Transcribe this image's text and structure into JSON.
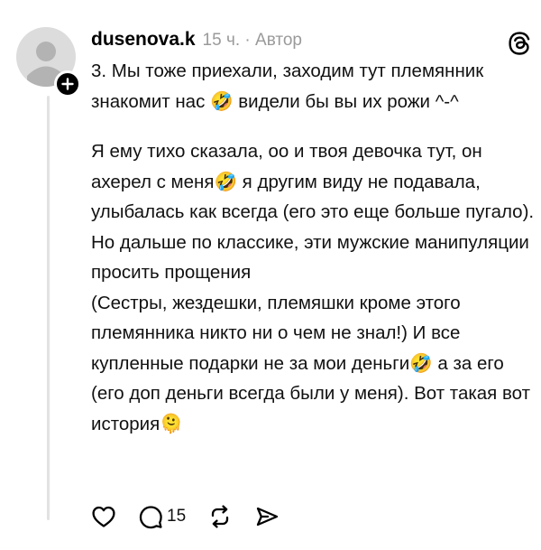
{
  "post": {
    "username": "dusenova.k",
    "time": "15 ч.",
    "separator": "·",
    "role": "Автор",
    "paragraph1": "3. Мы тоже приехали, заходим тут племянник знакомит нас 🤣 видели бы вы их рожи ^-^",
    "paragraph2": "Я ему тихо сказала,  оо и твоя девочка тут, он ахерел с меня🤣 я другим виду не подавала, улыбалась как всегда (его это еще больше пугало). Но дальше по классике, эти мужские манипуляции просить прощения",
    "paragraph3": "(Сестры, жездешки, племяшки кроме этого племянника никто ни о чем не знал!) И все купленные подарки не за мои деньги🤣 а за его (его доп деньги всегда были у меня). Вот такая вот история🫠"
  },
  "actions": {
    "reply_count": "15"
  },
  "icons": [
    "avatar-placeholder",
    "plus-icon",
    "threads-logo-icon",
    "heart-icon",
    "comment-icon",
    "repost-icon",
    "share-icon"
  ],
  "colors": {
    "text": "#111111",
    "meta": "#9a9a9a",
    "avatar_bg": "#dcdcdc",
    "thread_line": "#e2e2e2"
  }
}
